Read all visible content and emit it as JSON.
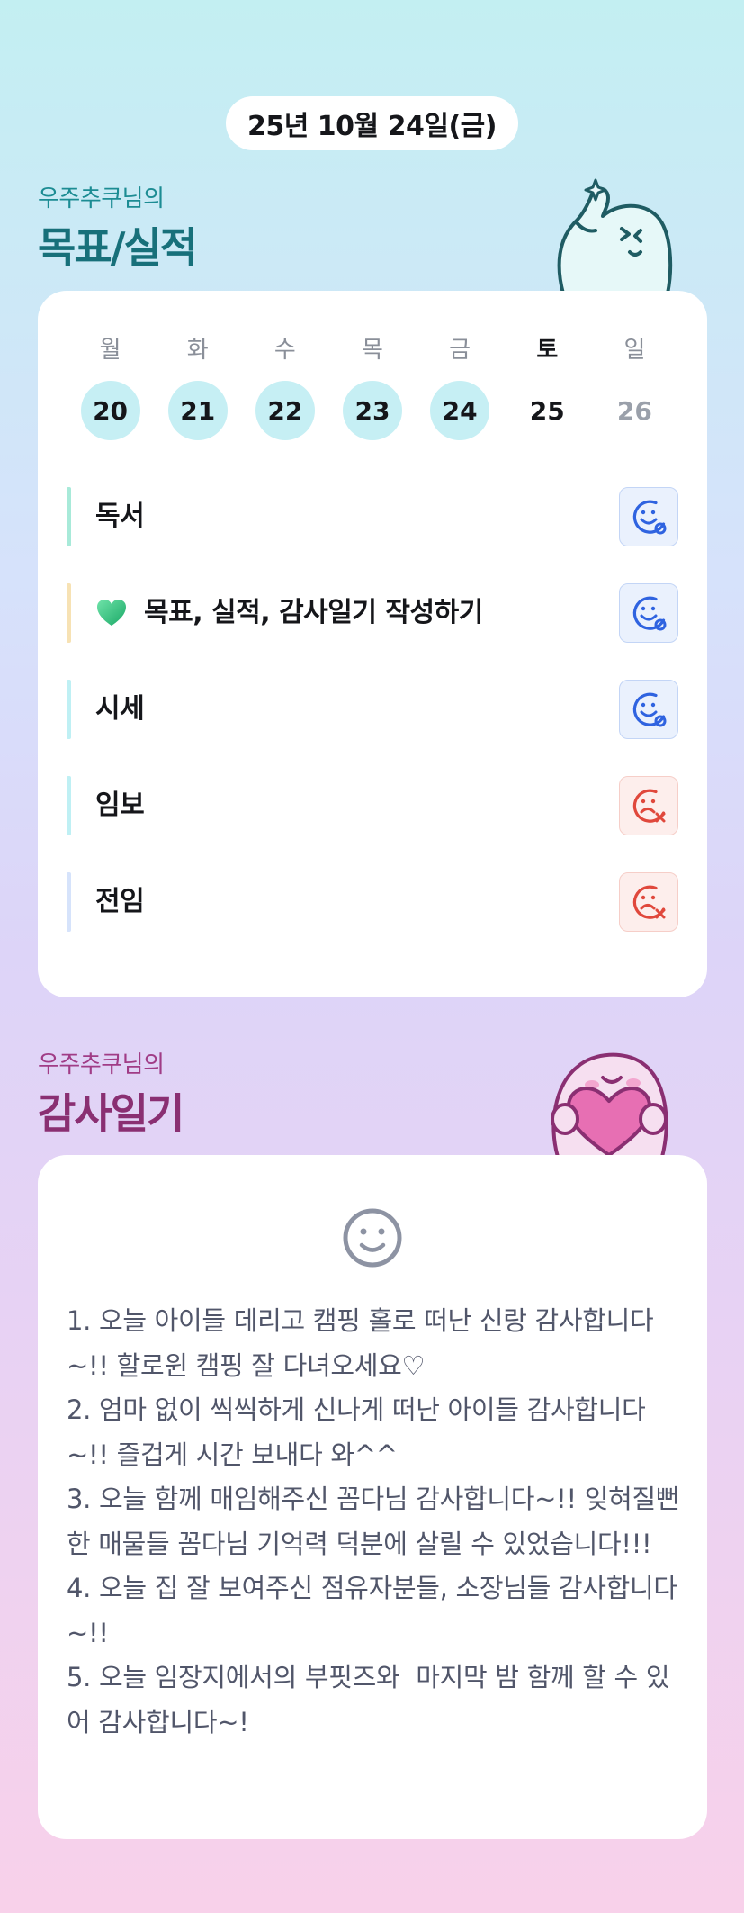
{
  "date": "25년 10월 24일(금)",
  "goals_section": {
    "owner": "우주추쿠님의",
    "title": "목표/실적"
  },
  "week": [
    {
      "label": "월",
      "num": "20",
      "state": "done"
    },
    {
      "label": "화",
      "num": "21",
      "state": "done"
    },
    {
      "label": "수",
      "num": "22",
      "state": "done"
    },
    {
      "label": "목",
      "num": "23",
      "state": "done"
    },
    {
      "label": "금",
      "num": "24",
      "state": "done"
    },
    {
      "label": "토",
      "num": "25",
      "state": "today"
    },
    {
      "label": "일",
      "num": "26",
      "state": "future"
    }
  ],
  "goals": [
    {
      "text": "독서",
      "bar_color": "#a8ead9",
      "status": "achieved",
      "has_heart": false
    },
    {
      "text": "목표, 실적, 감사일기 작성하기",
      "bar_color": "#f7e2b4",
      "status": "achieved",
      "has_heart": true
    },
    {
      "text": "시세",
      "bar_color": "#bff0f4",
      "status": "achieved",
      "has_heart": false
    },
    {
      "text": "임보",
      "bar_color": "#bff0f4",
      "status": "not-achieved",
      "has_heart": false
    },
    {
      "text": "전임",
      "bar_color": "#d6e3fb",
      "status": "not-achieved",
      "has_heart": false
    }
  ],
  "diary_section": {
    "owner": "우주추쿠님의",
    "title": "감사일기",
    "mood_icon": "smile-face-icon",
    "text": "1. 오늘 아이들 데리고 캠핑 홀로 떠난 신랑 감사합니다~!! 할로윈 캠핑 잘 다녀오세요♡\n2. 엄마 없이 씩씩하게 신나게 떠난 아이들 감사합니다~!! 즐겁게 시간 보내다 와^^\n3. 오늘 함께 매임해주신 꼼다님 감사합니다~!! 잊혀질뻔한 매물들 꼼다님 기억력 덕분에 살릴 수 있었습니다!!!\n4. 오늘 집 잘 보여주신 점유자분들, 소장님들 감사합니다~!!\n5. 오늘 임장지에서의 부핏즈와  마지막 밤 함께 할 수 있어 감사합니다~!"
  },
  "colors": {
    "done_day_bg": "#c6eff4",
    "achieved_icon": "#2f63e0",
    "not_achieved_icon": "#e0483c",
    "goals_title": "#17707a",
    "diary_title": "#8a2f72"
  }
}
